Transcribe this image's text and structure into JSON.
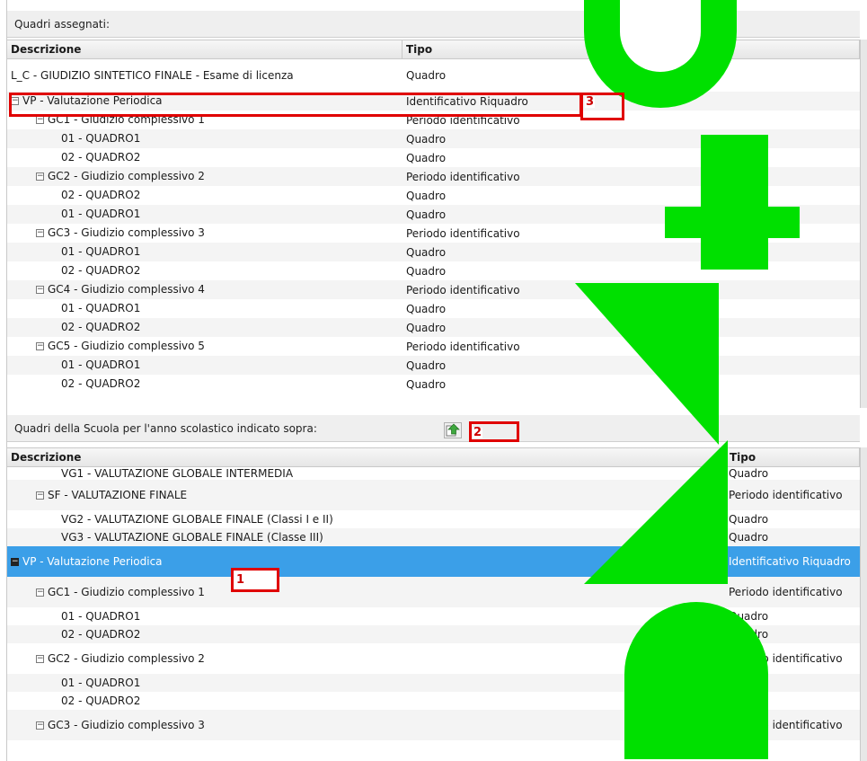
{
  "top": {
    "title": "Quadri assegnati:",
    "col_desc": "Descrizione",
    "col_tipo": "Tipo",
    "rows": [
      {
        "toggle": "",
        "indent": 0,
        "desc": "L_C - GIUDIZIO SINTETICO FINALE - Esame di licenza",
        "tipo": "Quadro"
      },
      {
        "toggle": "minus",
        "indent": 0,
        "desc": "VP - Valutazione Periodica",
        "tipo": "Identificativo Riquadro"
      },
      {
        "toggle": "minus",
        "indent": 1,
        "desc": "GC1 - Giudizio complessivo 1",
        "tipo": "Periodo identificativo"
      },
      {
        "toggle": "",
        "indent": 2,
        "desc": "01 - QUADRO1",
        "tipo": "Quadro"
      },
      {
        "toggle": "",
        "indent": 2,
        "desc": "02 - QUADRO2",
        "tipo": "Quadro"
      },
      {
        "toggle": "minus",
        "indent": 1,
        "desc": "GC2 - Giudizio complessivo 2",
        "tipo": "Periodo identificativo"
      },
      {
        "toggle": "",
        "indent": 2,
        "desc": "02 - QUADRO2",
        "tipo": "Quadro"
      },
      {
        "toggle": "",
        "indent": 2,
        "desc": "01 - QUADRO1",
        "tipo": "Quadro"
      },
      {
        "toggle": "minus",
        "indent": 1,
        "desc": "GC3 - Giudizio complessivo 3",
        "tipo": "Periodo identificativo"
      },
      {
        "toggle": "",
        "indent": 2,
        "desc": "01 - QUADRO1",
        "tipo": "Quadro"
      },
      {
        "toggle": "",
        "indent": 2,
        "desc": "02 - QUADRO2",
        "tipo": "Quadro"
      },
      {
        "toggle": "minus",
        "indent": 1,
        "desc": "GC4 - Giudizio complessivo 4",
        "tipo": "Periodo identificativo"
      },
      {
        "toggle": "",
        "indent": 2,
        "desc": "01 - QUADRO1",
        "tipo": "Quadro"
      },
      {
        "toggle": "",
        "indent": 2,
        "desc": "02 - QUADRO2",
        "tipo": "Quadro"
      },
      {
        "toggle": "minus",
        "indent": 1,
        "desc": "GC5 - Giudizio complessivo 5",
        "tipo": "Periodo identificativo"
      },
      {
        "toggle": "",
        "indent": 2,
        "desc": "01 - QUADRO1",
        "tipo": "Quadro"
      },
      {
        "toggle": "",
        "indent": 2,
        "desc": "02 - QUADRO2",
        "tipo": "Quadro"
      }
    ]
  },
  "bottom": {
    "title": "Quadri della Scuola per l'anno scolastico indicato sopra:",
    "col_desc": "Descrizione",
    "col_tipo": "Tipo",
    "rows": [
      {
        "toggle": "",
        "indent": 2,
        "desc": "VG1 - VALUTAZIONE GLOBALE INTERMEDIA",
        "tipo": "Quadro"
      },
      {
        "toggle": "minus",
        "indent": 1,
        "desc": "SF - VALUTAZIONE FINALE",
        "tipo": "Periodo identificativo"
      },
      {
        "toggle": "",
        "indent": 2,
        "desc": "VG2 - VALUTAZIONE GLOBALE FINALE (Classi I e II)",
        "tipo": "Quadro"
      },
      {
        "toggle": "",
        "indent": 2,
        "desc": "VG3 - VALUTAZIONE GLOBALE FINALE (Classe III)",
        "tipo": "Quadro"
      },
      {
        "toggle": "dark",
        "indent": 0,
        "desc": "VP - Valutazione Periodica",
        "tipo": "Identificativo Riquadro",
        "selected": true
      },
      {
        "toggle": "minus",
        "indent": 1,
        "desc": "GC1 - Giudizio complessivo 1",
        "tipo": "Periodo identificativo"
      },
      {
        "toggle": "",
        "indent": 2,
        "desc": "01 - QUADRO1",
        "tipo": "Quadro"
      },
      {
        "toggle": "",
        "indent": 2,
        "desc": "02 - QUADRO2",
        "tipo": "Quadro"
      },
      {
        "toggle": "minus",
        "indent": 1,
        "desc": "GC2 - Giudizio complessivo 2",
        "tipo": "Periodo identificativo"
      },
      {
        "toggle": "",
        "indent": 2,
        "desc": "01 - QUADRO1",
        "tipo": "Quadro"
      },
      {
        "toggle": "",
        "indent": 2,
        "desc": "02 - QUADRO2",
        "tipo": "Quadro"
      },
      {
        "toggle": "minus",
        "indent": 1,
        "desc": "GC3 - Giudizio complessivo 3",
        "tipo": "Periodo identificativo"
      }
    ]
  },
  "annotations": {
    "label1": "1",
    "label2": "2",
    "label3": "3"
  },
  "icons": {
    "move_up": "move-up-icon"
  },
  "colors": {
    "selection": "#3b9fe8",
    "highlight": "#e00000",
    "watermark": "#00e000"
  }
}
